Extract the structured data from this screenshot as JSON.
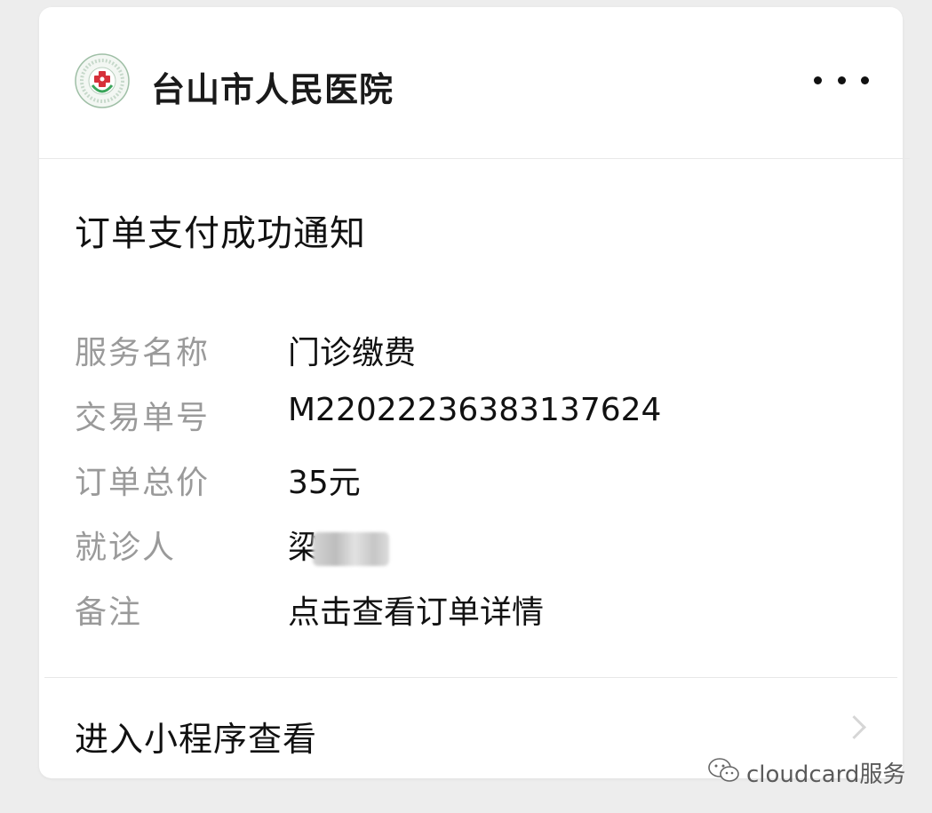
{
  "header": {
    "org_name": "台山市人民医院",
    "logo_icon": "hospital-logo-icon",
    "more_icon": "more-dots-icon"
  },
  "notice": {
    "title": "订单支付成功通知"
  },
  "fields": [
    {
      "label": "服务名称",
      "value": "门诊缴费"
    },
    {
      "label": "交易单号",
      "value": "M22022236383137624"
    },
    {
      "label": "订单总价",
      "value": "35元"
    },
    {
      "label": "就诊人",
      "value": "梁"
    },
    {
      "label": "备注",
      "value": "点击查看订单详情"
    }
  ],
  "footer": {
    "link_label": "进入小程序查看",
    "chevron_icon": "chevron-right-icon"
  },
  "watermark": {
    "text": "cloudcard服务",
    "icon": "wechat-icon"
  },
  "colors": {
    "background": "#ededed",
    "card": "#ffffff",
    "label": "#9a9a9a",
    "text": "#111111",
    "logo_red": "#d6303a",
    "logo_green": "#3aa55a"
  }
}
